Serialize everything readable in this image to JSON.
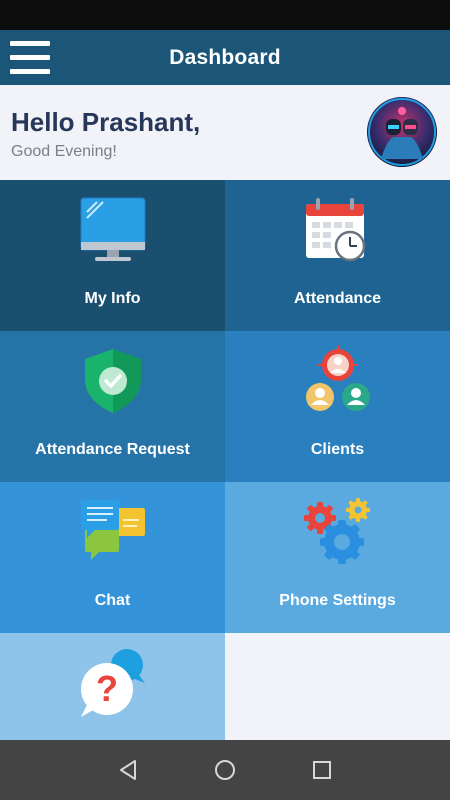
{
  "app_bar": {
    "title": "Dashboard",
    "menu_icon": "hamburger-menu-icon"
  },
  "greeting": {
    "hello": "Hello Prashant,",
    "subtitle": "Good Evening!"
  },
  "tiles": [
    {
      "label": "My Info",
      "icon": "monitor-icon",
      "color": "#1b4f70"
    },
    {
      "label": "Attendance",
      "icon": "calendar-clock-icon",
      "color": "#1e6391"
    },
    {
      "label": "Attendance Request",
      "icon": "shield-check-icon",
      "color": "#2673a8"
    },
    {
      "label": "Clients",
      "icon": "users-target-icon",
      "color": "#2a7fbf"
    },
    {
      "label": "Chat",
      "icon": "chat-bubbles-icon",
      "color": "#3493d9"
    },
    {
      "label": "Phone Settings",
      "icon": "gears-icon",
      "color": "#5aaae0"
    },
    {
      "label": "",
      "icon": "help-question-icon",
      "color": "#8ec4ea"
    }
  ],
  "nav": {
    "back_icon": "back-triangle-icon",
    "home_icon": "home-circle-icon",
    "recents_icon": "recents-square-icon"
  }
}
